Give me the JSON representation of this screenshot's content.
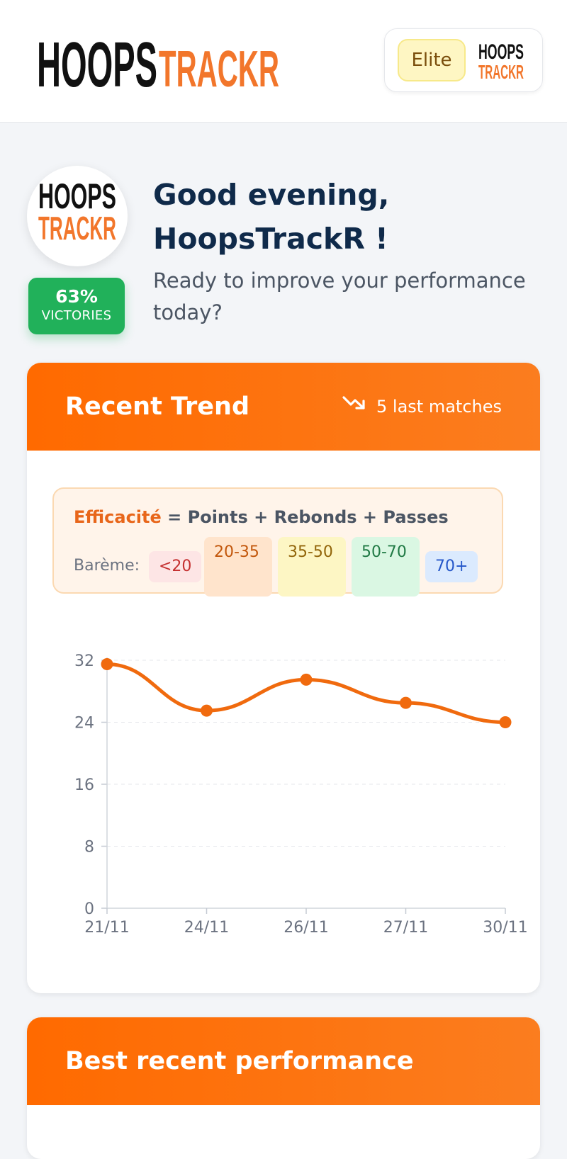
{
  "header": {
    "logo_text": [
      "HOOPS",
      "TRACKR"
    ],
    "tier_badge": "Elite"
  },
  "profile": {
    "win_rate": "63%",
    "win_label": "VICTORIES",
    "greeting_line1": "Good evening,",
    "greeting_line2": "HoopsTrackR !",
    "subtitle": "Ready to improve your performance today?"
  },
  "trend_card": {
    "title": "Recent Trend",
    "meta": "5 last matches",
    "legend": {
      "term": "Efficacité",
      "formula": " = Points + Rebonds + Passes",
      "scale_label": "Barème:",
      "ranges": [
        "<20",
        "20-35",
        "35-50",
        "50-70",
        "70+"
      ]
    }
  },
  "best_card": {
    "title": "Best recent performance"
  },
  "colors": {
    "accent": "#ff6a00",
    "line": "#f06a0e",
    "success": "#21b15a",
    "navy": "#0f2a4a"
  },
  "chart_data": {
    "type": "line",
    "categories": [
      "21/11",
      "24/11",
      "26/11",
      "27/11",
      "30/11"
    ],
    "series": [
      {
        "values": [
          31.5,
          25.5,
          29.5,
          26.5,
          24
        ]
      }
    ],
    "yticks": [
      0,
      8,
      16,
      24,
      32
    ],
    "ylim": [
      0,
      32
    ],
    "grid": true
  }
}
